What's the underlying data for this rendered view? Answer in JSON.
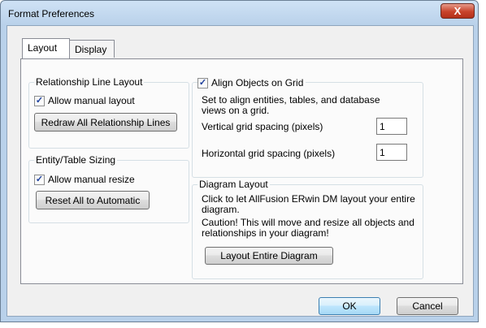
{
  "window": {
    "title": "Format Preferences",
    "close_glyph": "X"
  },
  "tabs": [
    {
      "label": "Layout",
      "active": true
    },
    {
      "label": "Display",
      "active": false
    }
  ],
  "relationship_group": {
    "label": "Relationship Line Layout",
    "checkbox_label": "Allow manual layout",
    "checked": true,
    "button_label": "Redraw All Relationship Lines"
  },
  "sizing_group": {
    "label": "Entity/Table Sizing",
    "checkbox_label": "Allow manual resize",
    "checked": true,
    "button_label": "Reset All to Automatic"
  },
  "grid_group": {
    "checkbox_label": "Align Objects on Grid",
    "checked": true,
    "description_1": "Set to align entities, tables, and database",
    "description_2": "views on a grid.",
    "vertical_label": "Vertical grid spacing (pixels)",
    "vertical_value": "1",
    "horizontal_label": "Horizontal grid spacing (pixels)",
    "horizontal_value": "1"
  },
  "diagram_group": {
    "label": "Diagram Layout",
    "line_1": "Click to let AllFusion ERwin DM layout your entire",
    "line_2": "diagram.",
    "line_3": "Caution! This will move and resize all objects and",
    "line_4": "relationships in your diagram!",
    "button_label": "Layout Entire Diagram"
  },
  "footer": {
    "ok_label": "OK",
    "cancel_label": "Cancel"
  },
  "check_glyph": "✓"
}
